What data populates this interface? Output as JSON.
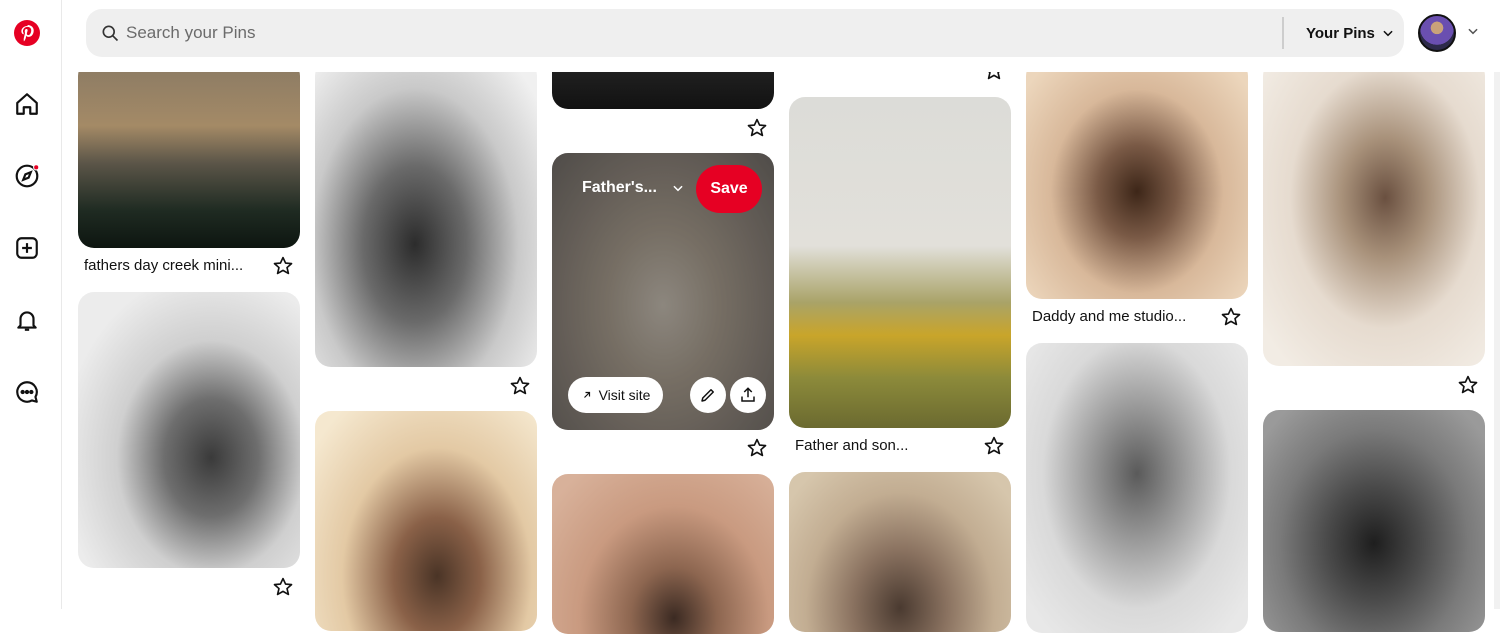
{
  "search": {
    "placeholder": "Search your Pins"
  },
  "header": {
    "your_pins_label": "Your Pins"
  },
  "sidebar": {
    "items": [
      "logo",
      "home",
      "explore",
      "create",
      "notifications",
      "messages"
    ]
  },
  "icons": {
    "logo": "pinterest-logo",
    "search": "search-icon",
    "chevron": "chevron-down-icon",
    "star": "star-icon",
    "edit": "pencil-icon",
    "share": "share-icon",
    "visit": "arrow-up-right-icon"
  },
  "colors": {
    "brand": "#e60023",
    "search_bg": "#efefef"
  },
  "pins": {
    "p1_title": "fathers day creek mini...",
    "p2_title": "Daddy and me studio...",
    "p3_title": "Father and son...",
    "hover": {
      "board": "Father's...",
      "save": "Save",
      "visit": "Visit site"
    }
  }
}
